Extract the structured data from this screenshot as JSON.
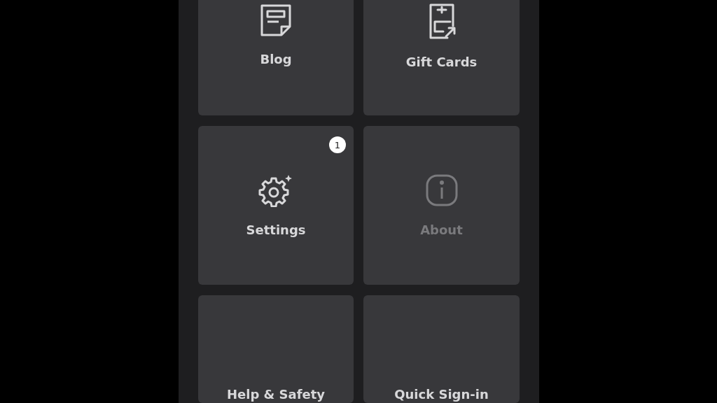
{
  "tiles": [
    {
      "kind": "blog",
      "label": "Blog",
      "disabled": false
    },
    {
      "kind": "gift",
      "label": "Gift Cards",
      "disabled": false
    },
    {
      "kind": "settings",
      "label": "Settings",
      "disabled": false,
      "badge": "1"
    },
    {
      "kind": "about",
      "label": "About",
      "disabled": true
    },
    {
      "kind": "help",
      "label": "Help & Safety",
      "disabled": false
    },
    {
      "kind": "signin",
      "label": "Quick Sign-in",
      "disabled": false
    }
  ]
}
